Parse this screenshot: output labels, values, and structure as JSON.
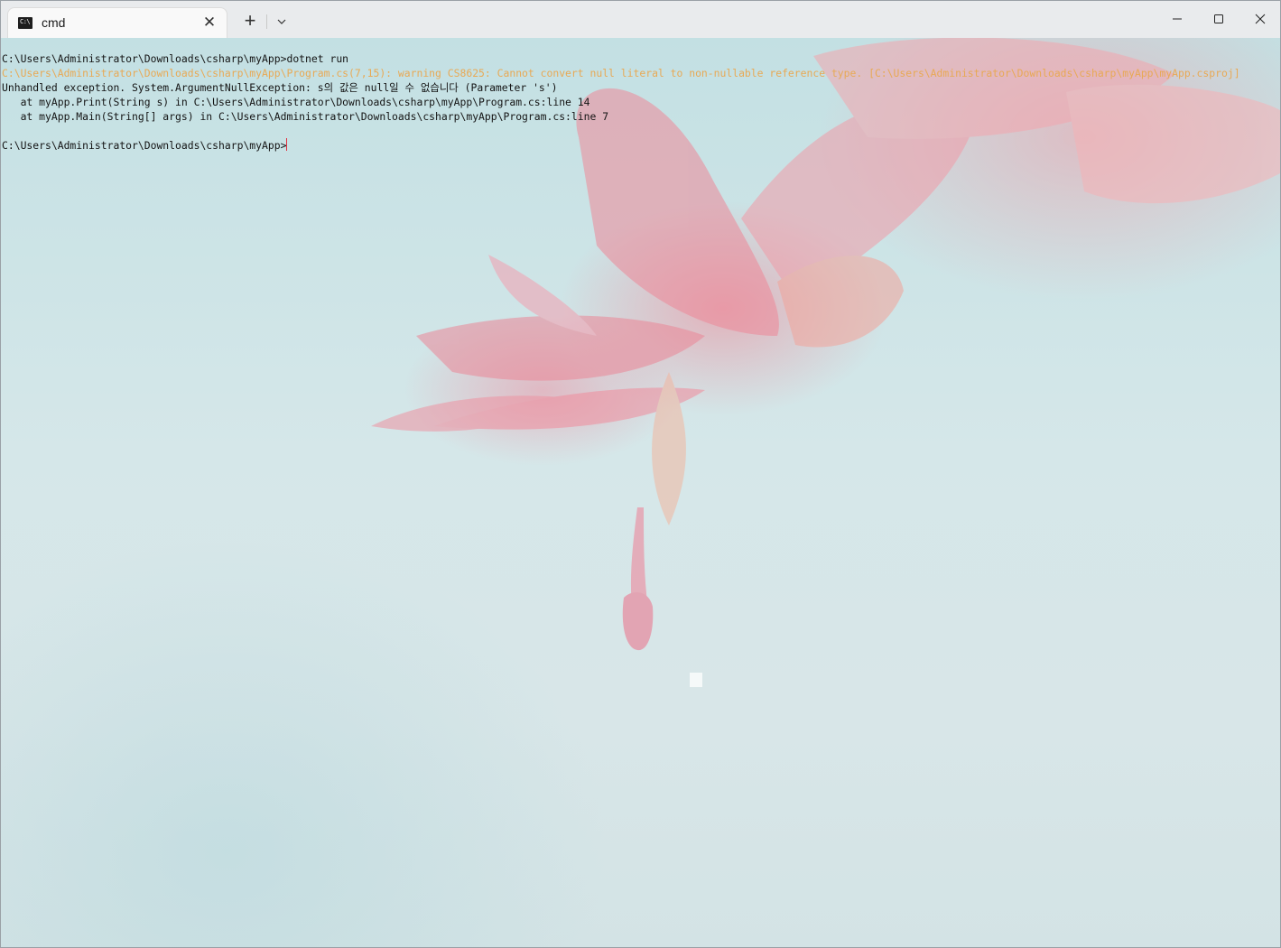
{
  "window": {
    "tab_title": "cmd",
    "tab_icon": "cmd-terminal-icon",
    "new_tab_icon": "plus-icon",
    "dropdown_icon": "chevron-down-icon",
    "tab_close_glyph": "✕",
    "new_tab_glyph": "+",
    "controls": [
      "minimize-icon",
      "maximize-icon",
      "close-icon"
    ]
  },
  "terminal": {
    "lines": [
      "C:\\Users\\Administrator\\Downloads\\csharp\\myApp>dotnet run",
      "C:\\Users\\Administrator\\Downloads\\csharp\\myApp\\Program.cs(7,15): warning CS8625: Cannot convert null literal to non-nullable reference type. [C:\\Users\\Administrator\\Downloads\\csharp\\myApp\\myApp.csproj]",
      "Unhandled exception. System.ArgumentNullException: s의 값은 null일 수 없습니다 (Parameter 's')",
      "   at myApp.Print(String s) in C:\\Users\\Administrator\\Downloads\\csharp\\myApp\\Program.cs:line 14",
      "   at myApp.Main(String[] args) in C:\\Users\\Administrator\\Downloads\\csharp\\myApp\\Program.cs:line 7",
      "",
      "C:\\Users\\Administrator\\Downloads\\csharp\\myApp>"
    ]
  },
  "colors": {
    "warning_text": "#e8a955",
    "normal_text": "#141414",
    "cursor": "#e03040"
  }
}
